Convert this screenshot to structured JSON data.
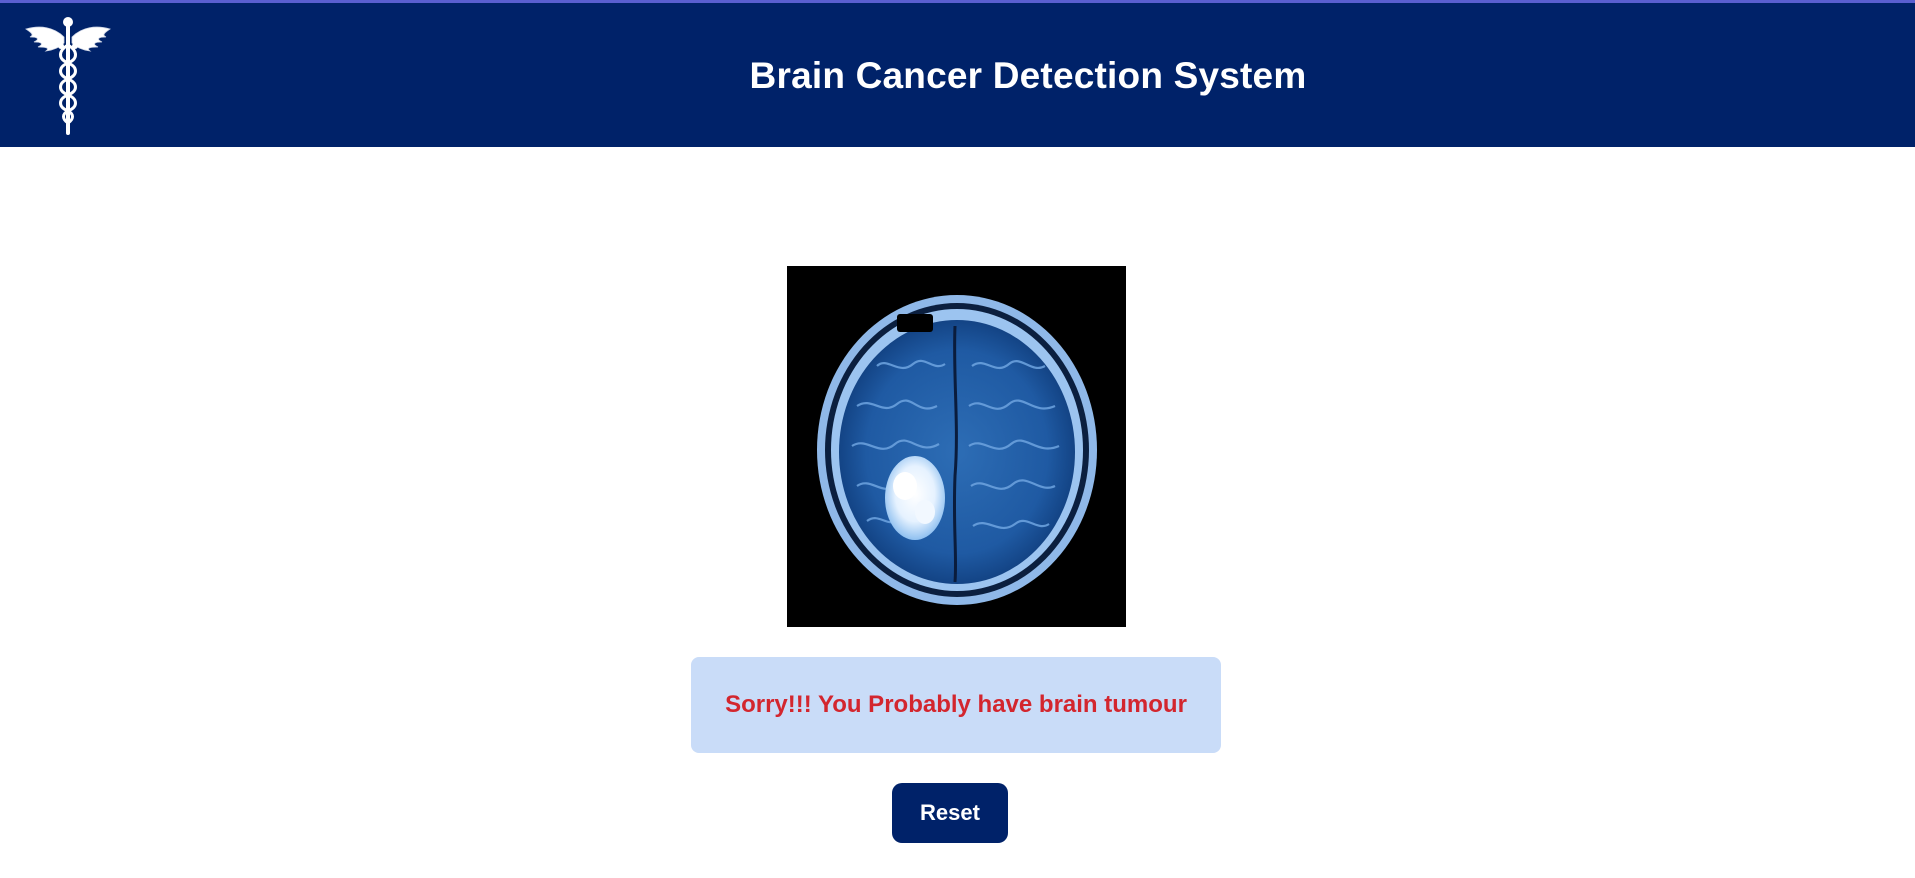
{
  "header": {
    "title": "Brain Cancer Detection System",
    "logo_icon": "caduceus-icon",
    "background_color": "#002269"
  },
  "scan": {
    "icon": "brain-mri-scan-image"
  },
  "result": {
    "message": "Sorry!!! You Probably have brain tumour",
    "text_color": "#d3262e",
    "background_color": "#c9dcf8"
  },
  "actions": {
    "reset_label": "Reset"
  }
}
